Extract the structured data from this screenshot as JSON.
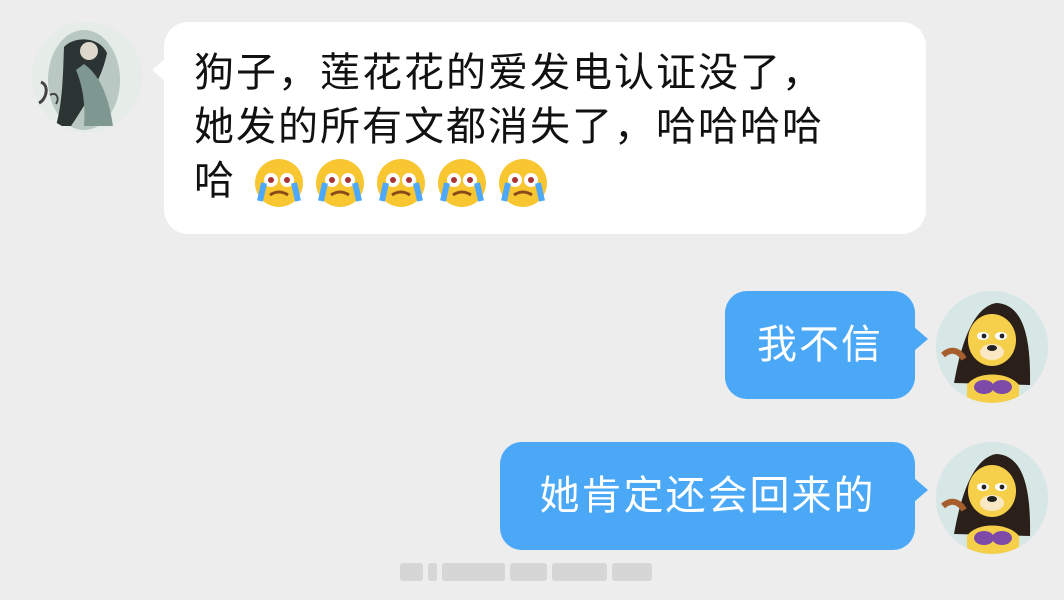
{
  "colors": {
    "background": "#ededed",
    "incoming_bubble": "#ffffff",
    "outgoing_bubble": "#4aa8f7",
    "outgoing_text": "#ffffff",
    "incoming_text": "#111111"
  },
  "messages": [
    {
      "direction": "incoming",
      "lines": [
        "狗子，莲花花的爱发电认证没了，",
        "她发的所有文都消失了，哈哈哈哈",
        "哈"
      ],
      "emoji": [
        "crying-face-icon",
        "crying-face-icon",
        "crying-face-icon",
        "crying-face-icon",
        "crying-face-icon"
      ]
    },
    {
      "direction": "outgoing",
      "text": "我不信"
    },
    {
      "direction": "outgoing",
      "text": "她肯定还会回来的"
    }
  ]
}
